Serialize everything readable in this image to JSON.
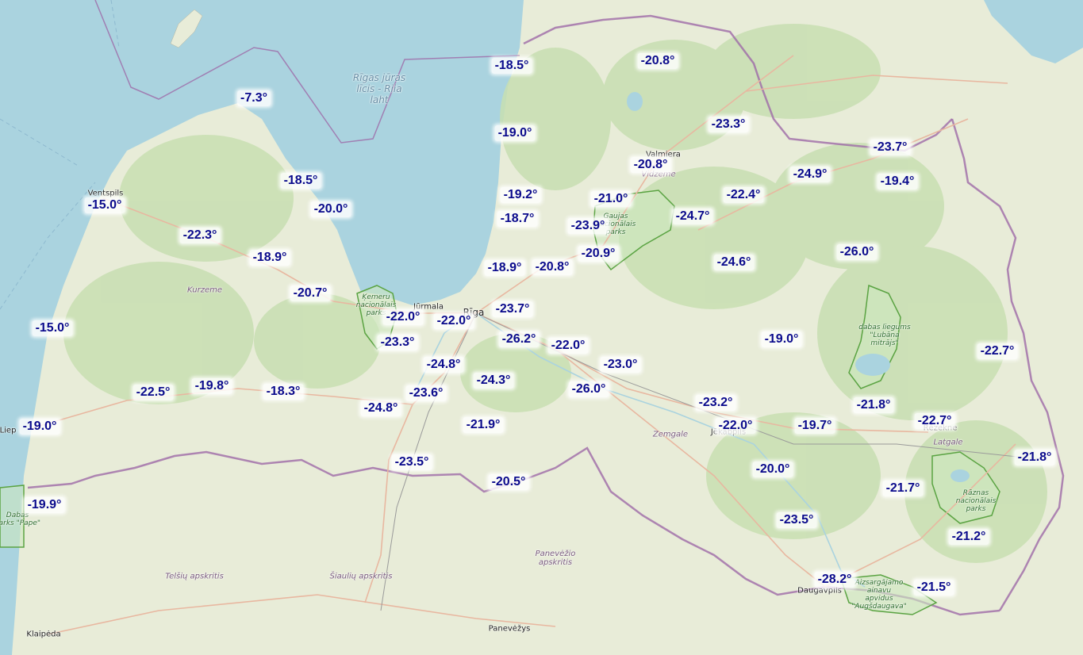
{
  "colors": {
    "sea": "#aad3df",
    "land": "#e8ecd8",
    "forest": "#c8dfb2",
    "park_border": "#5aa342",
    "border": "#9e6aa8",
    "temp_text": "#0a0a8c"
  },
  "places": {
    "ventspils": "Ventspils",
    "jurmala": "Jūrmala",
    "riga": "Rīga",
    "valmiera": "Valmiera",
    "jekabpils": "Jēkabpils",
    "rezekne": "Rēzekne",
    "daugavpils": "Daugavpils",
    "liepaja": "Liep",
    "klaipeda": "Klaipėda",
    "panevezys": "Panevėžys"
  },
  "regions": {
    "kurzeme": "Kurzeme",
    "vidzeme": "Vidzeme",
    "zemgale": "Zemgale",
    "latgale": "Latgale",
    "telsiu": "Telšių apskritis",
    "siauliu": "Šiaulių apskritis",
    "panevezio": [
      "Panevėžio",
      "apskritis"
    ]
  },
  "water": {
    "gulf": [
      "Rīgas jūras",
      "līcis - Riia",
      "laht"
    ]
  },
  "parks": {
    "kemeru": [
      "Ķemeru",
      "nacionālais",
      "parks"
    ],
    "gaujas": [
      "Gaujas",
      "nacionālais",
      "parks"
    ],
    "lubana": [
      "dabas liegums",
      "\"Lubāna",
      "mitrājs\""
    ],
    "raznas": [
      "Rāznas",
      "nacionālais",
      "parks"
    ],
    "pape": [
      "Dabas",
      "parks \"Pape\""
    ],
    "augsdaugava": [
      "Aizsargājamo",
      "ainavu",
      "apvidus",
      "\"Augšdaugava\""
    ]
  },
  "temperatures": [
    {
      "value": "-7.3°"
    },
    {
      "value": "-18.5°"
    },
    {
      "value": "-20.8°"
    },
    {
      "value": "-19.0°"
    },
    {
      "value": "-23.3°"
    },
    {
      "value": "-23.7°"
    },
    {
      "value": "-18.5°"
    },
    {
      "value": "-20.8°"
    },
    {
      "value": "-24.9°"
    },
    {
      "value": "-19.4°"
    },
    {
      "value": "-15.0°"
    },
    {
      "value": "-19.2°"
    },
    {
      "value": "-21.0°"
    },
    {
      "value": "-22.4°"
    },
    {
      "value": "-20.0°"
    },
    {
      "value": "-18.7°"
    },
    {
      "value": "-24.7°"
    },
    {
      "value": "-22.3°"
    },
    {
      "value": "-23.9°"
    },
    {
      "value": "-18.9°"
    },
    {
      "value": "-20.9°"
    },
    {
      "value": "-26.0°"
    },
    {
      "value": "-18.9°"
    },
    {
      "value": "-20.8°"
    },
    {
      "value": "-24.6°"
    },
    {
      "value": "-20.7°"
    },
    {
      "value": "-23.7°"
    },
    {
      "value": "-22.0°"
    },
    {
      "value": "-22.0°"
    },
    {
      "value": "-15.0°"
    },
    {
      "value": "-23.3°"
    },
    {
      "value": "-26.2°"
    },
    {
      "value": "-22.0°"
    },
    {
      "value": "-19.0°"
    },
    {
      "value": "-22.7°"
    },
    {
      "value": "-24.8°"
    },
    {
      "value": "-23.0°"
    },
    {
      "value": "-24.3°"
    },
    {
      "value": "-19.8°"
    },
    {
      "value": "-22.5°"
    },
    {
      "value": "-18.3°"
    },
    {
      "value": "-23.6°"
    },
    {
      "value": "-26.0°"
    },
    {
      "value": "-23.2°"
    },
    {
      "value": "-21.8°"
    },
    {
      "value": "-24.8°"
    },
    {
      "value": "-19.0°"
    },
    {
      "value": "-21.9°"
    },
    {
      "value": "-22.0°"
    },
    {
      "value": "-19.7°"
    },
    {
      "value": "-22.7°"
    },
    {
      "value": "-23.5°"
    },
    {
      "value": "-21.8°"
    },
    {
      "value": "-20.0°"
    },
    {
      "value": "-20.5°"
    },
    {
      "value": "-19.9°"
    },
    {
      "value": "-21.7°"
    },
    {
      "value": "-23.5°"
    },
    {
      "value": "-21.2°"
    },
    {
      "value": "-28.2°"
    },
    {
      "value": "-21.5°"
    }
  ]
}
